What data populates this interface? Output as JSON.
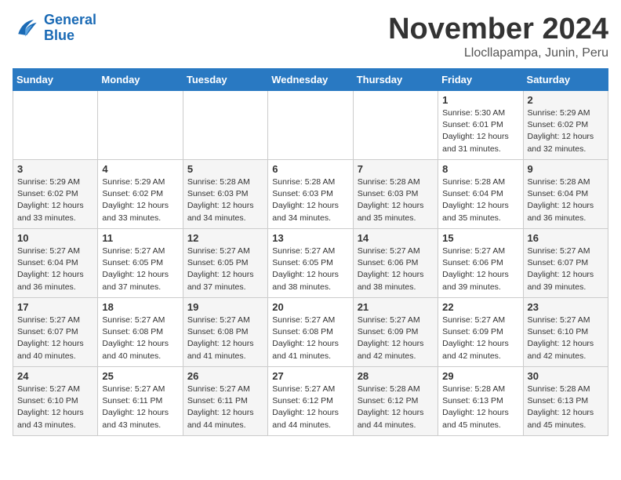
{
  "header": {
    "logo_line1": "General",
    "logo_line2": "Blue",
    "month": "November 2024",
    "location": "Llocllapampa, Junin, Peru"
  },
  "weekdays": [
    "Sunday",
    "Monday",
    "Tuesday",
    "Wednesday",
    "Thursday",
    "Friday",
    "Saturday"
  ],
  "weeks": [
    [
      {
        "day": "",
        "info": ""
      },
      {
        "day": "",
        "info": ""
      },
      {
        "day": "",
        "info": ""
      },
      {
        "day": "",
        "info": ""
      },
      {
        "day": "",
        "info": ""
      },
      {
        "day": "1",
        "info": "Sunrise: 5:30 AM\nSunset: 6:01 PM\nDaylight: 12 hours\nand 31 minutes."
      },
      {
        "day": "2",
        "info": "Sunrise: 5:29 AM\nSunset: 6:02 PM\nDaylight: 12 hours\nand 32 minutes."
      }
    ],
    [
      {
        "day": "3",
        "info": "Sunrise: 5:29 AM\nSunset: 6:02 PM\nDaylight: 12 hours\nand 33 minutes."
      },
      {
        "day": "4",
        "info": "Sunrise: 5:29 AM\nSunset: 6:02 PM\nDaylight: 12 hours\nand 33 minutes."
      },
      {
        "day": "5",
        "info": "Sunrise: 5:28 AM\nSunset: 6:03 PM\nDaylight: 12 hours\nand 34 minutes."
      },
      {
        "day": "6",
        "info": "Sunrise: 5:28 AM\nSunset: 6:03 PM\nDaylight: 12 hours\nand 34 minutes."
      },
      {
        "day": "7",
        "info": "Sunrise: 5:28 AM\nSunset: 6:03 PM\nDaylight: 12 hours\nand 35 minutes."
      },
      {
        "day": "8",
        "info": "Sunrise: 5:28 AM\nSunset: 6:04 PM\nDaylight: 12 hours\nand 35 minutes."
      },
      {
        "day": "9",
        "info": "Sunrise: 5:28 AM\nSunset: 6:04 PM\nDaylight: 12 hours\nand 36 minutes."
      }
    ],
    [
      {
        "day": "10",
        "info": "Sunrise: 5:27 AM\nSunset: 6:04 PM\nDaylight: 12 hours\nand 36 minutes."
      },
      {
        "day": "11",
        "info": "Sunrise: 5:27 AM\nSunset: 6:05 PM\nDaylight: 12 hours\nand 37 minutes."
      },
      {
        "day": "12",
        "info": "Sunrise: 5:27 AM\nSunset: 6:05 PM\nDaylight: 12 hours\nand 37 minutes."
      },
      {
        "day": "13",
        "info": "Sunrise: 5:27 AM\nSunset: 6:05 PM\nDaylight: 12 hours\nand 38 minutes."
      },
      {
        "day": "14",
        "info": "Sunrise: 5:27 AM\nSunset: 6:06 PM\nDaylight: 12 hours\nand 38 minutes."
      },
      {
        "day": "15",
        "info": "Sunrise: 5:27 AM\nSunset: 6:06 PM\nDaylight: 12 hours\nand 39 minutes."
      },
      {
        "day": "16",
        "info": "Sunrise: 5:27 AM\nSunset: 6:07 PM\nDaylight: 12 hours\nand 39 minutes."
      }
    ],
    [
      {
        "day": "17",
        "info": "Sunrise: 5:27 AM\nSunset: 6:07 PM\nDaylight: 12 hours\nand 40 minutes."
      },
      {
        "day": "18",
        "info": "Sunrise: 5:27 AM\nSunset: 6:08 PM\nDaylight: 12 hours\nand 40 minutes."
      },
      {
        "day": "19",
        "info": "Sunrise: 5:27 AM\nSunset: 6:08 PM\nDaylight: 12 hours\nand 41 minutes."
      },
      {
        "day": "20",
        "info": "Sunrise: 5:27 AM\nSunset: 6:08 PM\nDaylight: 12 hours\nand 41 minutes."
      },
      {
        "day": "21",
        "info": "Sunrise: 5:27 AM\nSunset: 6:09 PM\nDaylight: 12 hours\nand 42 minutes."
      },
      {
        "day": "22",
        "info": "Sunrise: 5:27 AM\nSunset: 6:09 PM\nDaylight: 12 hours\nand 42 minutes."
      },
      {
        "day": "23",
        "info": "Sunrise: 5:27 AM\nSunset: 6:10 PM\nDaylight: 12 hours\nand 42 minutes."
      }
    ],
    [
      {
        "day": "24",
        "info": "Sunrise: 5:27 AM\nSunset: 6:10 PM\nDaylight: 12 hours\nand 43 minutes."
      },
      {
        "day": "25",
        "info": "Sunrise: 5:27 AM\nSunset: 6:11 PM\nDaylight: 12 hours\nand 43 minutes."
      },
      {
        "day": "26",
        "info": "Sunrise: 5:27 AM\nSunset: 6:11 PM\nDaylight: 12 hours\nand 44 minutes."
      },
      {
        "day": "27",
        "info": "Sunrise: 5:27 AM\nSunset: 6:12 PM\nDaylight: 12 hours\nand 44 minutes."
      },
      {
        "day": "28",
        "info": "Sunrise: 5:28 AM\nSunset: 6:12 PM\nDaylight: 12 hours\nand 44 minutes."
      },
      {
        "day": "29",
        "info": "Sunrise: 5:28 AM\nSunset: 6:13 PM\nDaylight: 12 hours\nand 45 minutes."
      },
      {
        "day": "30",
        "info": "Sunrise: 5:28 AM\nSunset: 6:13 PM\nDaylight: 12 hours\nand 45 minutes."
      }
    ]
  ]
}
